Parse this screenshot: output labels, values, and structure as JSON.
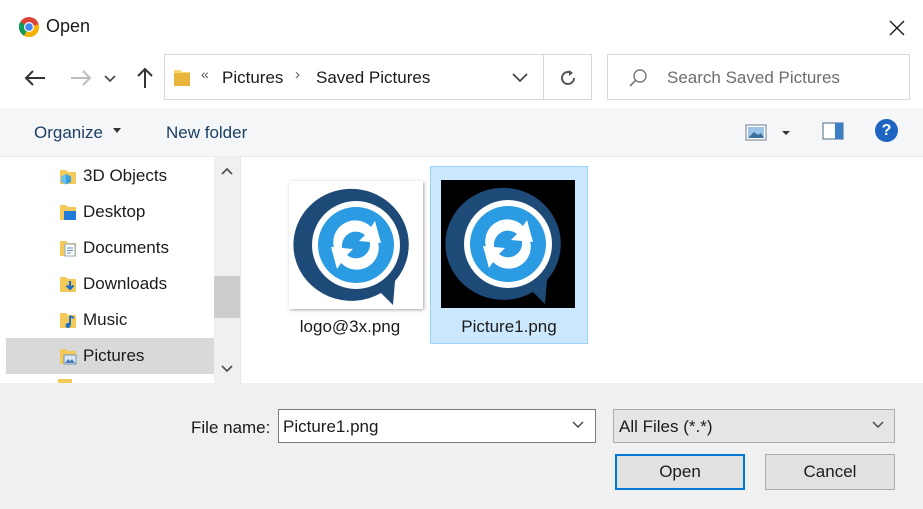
{
  "window": {
    "title": "Open",
    "icon": "chrome-icon"
  },
  "nav": {
    "back_icon": "arrow-left-icon",
    "forward_icon": "arrow-right-icon",
    "recent_icon": "chevron-down-icon",
    "up_icon": "arrow-up-icon"
  },
  "address": {
    "overflow_glyph": "«",
    "separator": "›",
    "crumbs": [
      "Pictures",
      "Saved Pictures"
    ]
  },
  "search": {
    "placeholder": "Search Saved Pictures"
  },
  "toolbar": {
    "organize_label": "Organize",
    "new_folder_label": "New folder",
    "help_label": "?"
  },
  "sidebar": {
    "items": [
      {
        "label": "3D Objects",
        "icon": "3d-objects-icon"
      },
      {
        "label": "Desktop",
        "icon": "desktop-folder-icon"
      },
      {
        "label": "Documents",
        "icon": "documents-icon"
      },
      {
        "label": "Downloads",
        "icon": "downloads-icon"
      },
      {
        "label": "Music",
        "icon": "music-icon"
      },
      {
        "label": "Pictures",
        "icon": "pictures-icon",
        "selected": true
      }
    ]
  },
  "files": [
    {
      "name": "logo@3x.png",
      "selected": false,
      "thumb_bg": "#ffffff"
    },
    {
      "name": "Picture1.png",
      "selected": true,
      "thumb_bg": "#000000"
    }
  ],
  "bottom": {
    "file_name_label": "File name:",
    "file_name_value": "Picture1.png",
    "filter_value": "All Files (*.*)",
    "open_label": "Open",
    "cancel_label": "Cancel"
  },
  "colors": {
    "accent": "#0078d7",
    "logo_dark": "#1e4a78",
    "logo_light": "#2b9be4",
    "selection": "#cce8ff"
  }
}
